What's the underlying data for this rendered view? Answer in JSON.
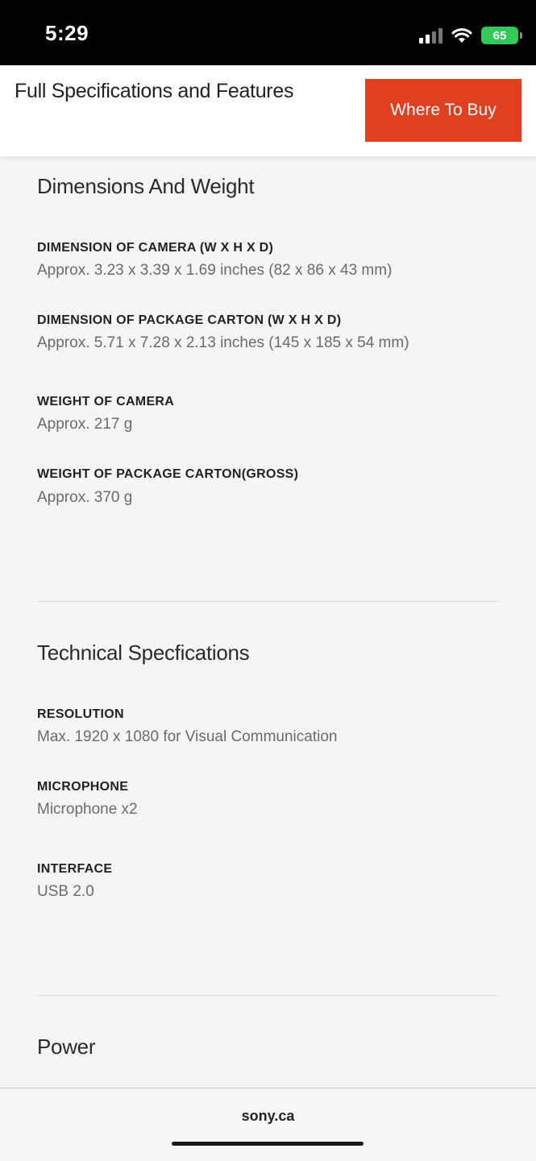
{
  "status_bar": {
    "time": "5:29",
    "battery": "65"
  },
  "header": {
    "title": "Full Specifications and Features",
    "where_to_buy_label": "Where To Buy",
    "accent_color": "#e0401f"
  },
  "sections": {
    "dimensions": {
      "title": "Dimensions And Weight",
      "specs": [
        {
          "label": "DIMENSION OF CAMERA (W X H X D)",
          "value": "Approx. 3.23 x 3.39 x 1.69 inches (82 x 86 x 43 mm)"
        },
        {
          "label": "DIMENSION OF PACKAGE CARTON (W X H X D)",
          "value": "Approx. 5.71 x 7.28 x 2.13 inches (145 x 185 x 54 mm)"
        },
        {
          "label": "WEIGHT OF CAMERA",
          "value": "Approx. 217 g"
        },
        {
          "label": "WEIGHT OF PACKAGE CARTON(GROSS)",
          "value": "Approx. 370 g"
        }
      ]
    },
    "technical": {
      "title": "Technical Specfications",
      "specs": [
        {
          "label": "RESOLUTION",
          "value": "Max. 1920 x 1080 for Visual Communication"
        },
        {
          "label": "MICROPHONE",
          "value": "Microphone x2"
        },
        {
          "label": "INTERFACE",
          "value": "USB 2.0"
        }
      ]
    },
    "power": {
      "title": "Power"
    }
  },
  "browser": {
    "url": "sony.ca"
  }
}
